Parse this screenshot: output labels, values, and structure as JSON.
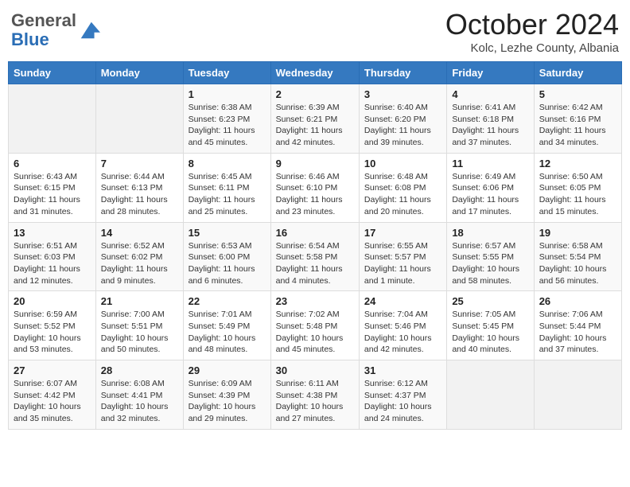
{
  "header": {
    "logo_general": "General",
    "logo_blue": "Blue",
    "month": "October 2024",
    "location": "Kolc, Lezhe County, Albania"
  },
  "days_of_week": [
    "Sunday",
    "Monday",
    "Tuesday",
    "Wednesday",
    "Thursday",
    "Friday",
    "Saturday"
  ],
  "weeks": [
    [
      {
        "num": "",
        "info": ""
      },
      {
        "num": "",
        "info": ""
      },
      {
        "num": "1",
        "info": "Sunrise: 6:38 AM\nSunset: 6:23 PM\nDaylight: 11 hours and 45 minutes."
      },
      {
        "num": "2",
        "info": "Sunrise: 6:39 AM\nSunset: 6:21 PM\nDaylight: 11 hours and 42 minutes."
      },
      {
        "num": "3",
        "info": "Sunrise: 6:40 AM\nSunset: 6:20 PM\nDaylight: 11 hours and 39 minutes."
      },
      {
        "num": "4",
        "info": "Sunrise: 6:41 AM\nSunset: 6:18 PM\nDaylight: 11 hours and 37 minutes."
      },
      {
        "num": "5",
        "info": "Sunrise: 6:42 AM\nSunset: 6:16 PM\nDaylight: 11 hours and 34 minutes."
      }
    ],
    [
      {
        "num": "6",
        "info": "Sunrise: 6:43 AM\nSunset: 6:15 PM\nDaylight: 11 hours and 31 minutes."
      },
      {
        "num": "7",
        "info": "Sunrise: 6:44 AM\nSunset: 6:13 PM\nDaylight: 11 hours and 28 minutes."
      },
      {
        "num": "8",
        "info": "Sunrise: 6:45 AM\nSunset: 6:11 PM\nDaylight: 11 hours and 25 minutes."
      },
      {
        "num": "9",
        "info": "Sunrise: 6:46 AM\nSunset: 6:10 PM\nDaylight: 11 hours and 23 minutes."
      },
      {
        "num": "10",
        "info": "Sunrise: 6:48 AM\nSunset: 6:08 PM\nDaylight: 11 hours and 20 minutes."
      },
      {
        "num": "11",
        "info": "Sunrise: 6:49 AM\nSunset: 6:06 PM\nDaylight: 11 hours and 17 minutes."
      },
      {
        "num": "12",
        "info": "Sunrise: 6:50 AM\nSunset: 6:05 PM\nDaylight: 11 hours and 15 minutes."
      }
    ],
    [
      {
        "num": "13",
        "info": "Sunrise: 6:51 AM\nSunset: 6:03 PM\nDaylight: 11 hours and 12 minutes."
      },
      {
        "num": "14",
        "info": "Sunrise: 6:52 AM\nSunset: 6:02 PM\nDaylight: 11 hours and 9 minutes."
      },
      {
        "num": "15",
        "info": "Sunrise: 6:53 AM\nSunset: 6:00 PM\nDaylight: 11 hours and 6 minutes."
      },
      {
        "num": "16",
        "info": "Sunrise: 6:54 AM\nSunset: 5:58 PM\nDaylight: 11 hours and 4 minutes."
      },
      {
        "num": "17",
        "info": "Sunrise: 6:55 AM\nSunset: 5:57 PM\nDaylight: 11 hours and 1 minute."
      },
      {
        "num": "18",
        "info": "Sunrise: 6:57 AM\nSunset: 5:55 PM\nDaylight: 10 hours and 58 minutes."
      },
      {
        "num": "19",
        "info": "Sunrise: 6:58 AM\nSunset: 5:54 PM\nDaylight: 10 hours and 56 minutes."
      }
    ],
    [
      {
        "num": "20",
        "info": "Sunrise: 6:59 AM\nSunset: 5:52 PM\nDaylight: 10 hours and 53 minutes."
      },
      {
        "num": "21",
        "info": "Sunrise: 7:00 AM\nSunset: 5:51 PM\nDaylight: 10 hours and 50 minutes."
      },
      {
        "num": "22",
        "info": "Sunrise: 7:01 AM\nSunset: 5:49 PM\nDaylight: 10 hours and 48 minutes."
      },
      {
        "num": "23",
        "info": "Sunrise: 7:02 AM\nSunset: 5:48 PM\nDaylight: 10 hours and 45 minutes."
      },
      {
        "num": "24",
        "info": "Sunrise: 7:04 AM\nSunset: 5:46 PM\nDaylight: 10 hours and 42 minutes."
      },
      {
        "num": "25",
        "info": "Sunrise: 7:05 AM\nSunset: 5:45 PM\nDaylight: 10 hours and 40 minutes."
      },
      {
        "num": "26",
        "info": "Sunrise: 7:06 AM\nSunset: 5:44 PM\nDaylight: 10 hours and 37 minutes."
      }
    ],
    [
      {
        "num": "27",
        "info": "Sunrise: 6:07 AM\nSunset: 4:42 PM\nDaylight: 10 hours and 35 minutes."
      },
      {
        "num": "28",
        "info": "Sunrise: 6:08 AM\nSunset: 4:41 PM\nDaylight: 10 hours and 32 minutes."
      },
      {
        "num": "29",
        "info": "Sunrise: 6:09 AM\nSunset: 4:39 PM\nDaylight: 10 hours and 29 minutes."
      },
      {
        "num": "30",
        "info": "Sunrise: 6:11 AM\nSunset: 4:38 PM\nDaylight: 10 hours and 27 minutes."
      },
      {
        "num": "31",
        "info": "Sunrise: 6:12 AM\nSunset: 4:37 PM\nDaylight: 10 hours and 24 minutes."
      },
      {
        "num": "",
        "info": ""
      },
      {
        "num": "",
        "info": ""
      }
    ]
  ]
}
